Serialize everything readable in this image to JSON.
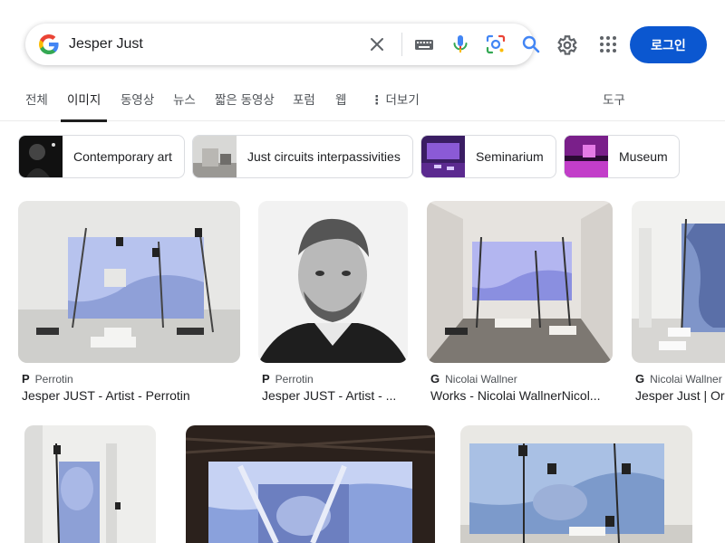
{
  "search": {
    "value": "Jesper Just",
    "clear_icon": "close-icon",
    "keyboard_icon": "keyboard-icon",
    "mic_icon": "mic-icon",
    "lens_icon": "camera-lens-icon",
    "search_icon": "search-icon"
  },
  "header": {
    "login_label": "로그인",
    "settings_icon": "gear-icon",
    "apps_icon": "apps-grid-icon"
  },
  "tabs": [
    {
      "label": "전체"
    },
    {
      "label": "이미지",
      "active": true
    },
    {
      "label": "동영상"
    },
    {
      "label": "뉴스"
    },
    {
      "label": "짧은 동영상"
    },
    {
      "label": "포럼"
    },
    {
      "label": "웹"
    },
    {
      "label": "더보기"
    },
    {
      "label": "도구"
    }
  ],
  "chips": [
    {
      "label": "Contemporary art"
    },
    {
      "label": "Just circuits interpassivities"
    },
    {
      "label": "Seminarium"
    },
    {
      "label": "Museum"
    }
  ],
  "results": [
    {
      "source_icon": "P",
      "source": "Perrotin",
      "title": "Jesper JUST - Artist - Perrotin"
    },
    {
      "source_icon": "P",
      "source": "Perrotin",
      "title": "Jesper JUST - Artist - ..."
    },
    {
      "source_icon": "G",
      "source": "Nicolai Wallner",
      "title": "Works - Nicolai WallnerNicol..."
    },
    {
      "source_icon": "G",
      "source": "Nicolai Wallner",
      "title": "Jesper Just | Or"
    }
  ],
  "colors": {
    "accent": "#0b57d0",
    "google_blue": "#4285F4",
    "google_red": "#EA4335",
    "google_yellow": "#FBBC05",
    "google_green": "#34A853"
  }
}
